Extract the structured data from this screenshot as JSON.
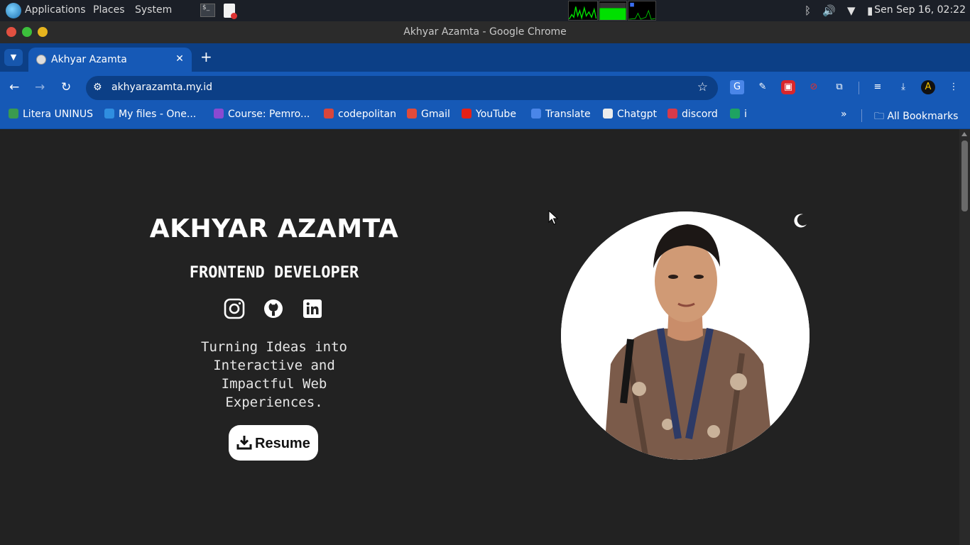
{
  "desktop_panel": {
    "menu": [
      "Applications",
      "Places",
      "System"
    ],
    "terminal_icon_text": "$_",
    "clock": "Sen Sep 16, 02:22"
  },
  "window": {
    "title": "Akhyar Azamta - Google Chrome"
  },
  "tabs": [
    {
      "label": "Akhyar Azamta",
      "active": true
    }
  ],
  "toolbar": {
    "url": "akhyarazamta.my.id"
  },
  "bookmarks": [
    {
      "label": "Litera UNINUS",
      "color": "#3a9b4f"
    },
    {
      "label": "My files - One...",
      "color": "#2f8ee0"
    },
    {
      "label": "Course: Pemro...",
      "color": "#8a4ad1"
    },
    {
      "label": "codepolitan",
      "color": "#d9463b"
    },
    {
      "label": "Gmail",
      "color": "#e04b3a"
    },
    {
      "label": "YouTube",
      "color": "#e62117"
    },
    {
      "label": "Translate",
      "color": "#4a86e8"
    },
    {
      "label": "Chatgpt",
      "color": "#ececec"
    },
    {
      "label": "discord",
      "color": "#d63a4a"
    },
    {
      "label": "i",
      "color": "#1ea362"
    }
  ],
  "all_bookmarks": "All Bookmarks",
  "hero": {
    "name": "AKHYAR AZAMTA",
    "role": "FRONTEND DEVELOPER",
    "tagline_lines": [
      "Turning Ideas into",
      "Interactive and",
      "Impactful Web",
      "Experiences."
    ],
    "resume_label": "Resume"
  },
  "icons": {
    "instagram": "instagram-icon",
    "github": "github-icon",
    "linkedin": "linkedin-icon",
    "theme_toggle": "moon-icon"
  }
}
